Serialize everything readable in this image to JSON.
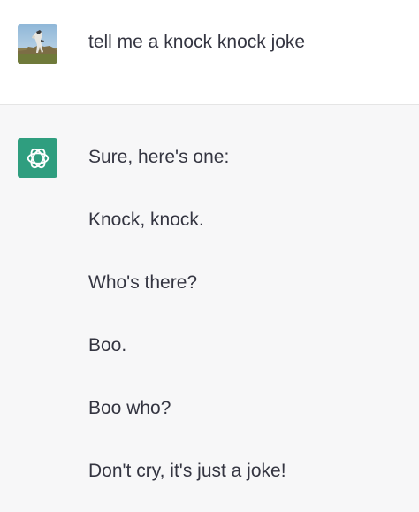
{
  "user_message": {
    "avatar_icon": "user-photo-avatar",
    "text": "tell me a knock knock joke"
  },
  "assistant_message": {
    "avatar_icon": "openai-logo-icon",
    "avatar_color": "#2f9e7f",
    "lines": [
      "Sure, here's one:",
      "Knock, knock.",
      "Who's there?",
      "Boo.",
      "Boo who?",
      "Don't cry, it's just a joke!"
    ]
  }
}
